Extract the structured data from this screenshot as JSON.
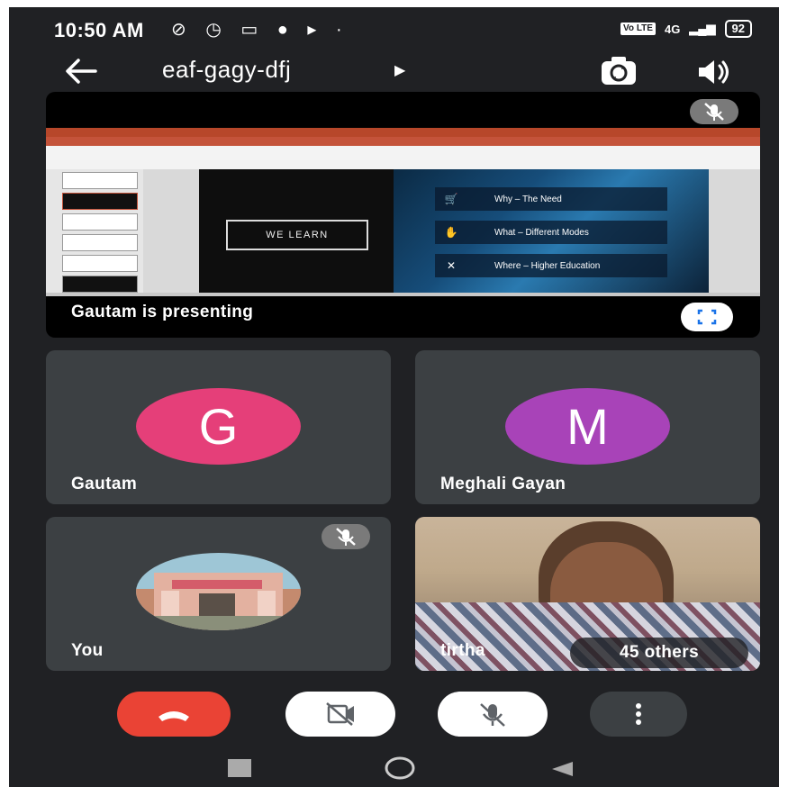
{
  "status_bar": {
    "time": "10:50 AM",
    "network": "4G",
    "network_badge": "Vo LTE",
    "battery": "92"
  },
  "header": {
    "meeting_code": "eaf-gagy-dfj"
  },
  "presentation": {
    "label": "Gautam is presenting",
    "slide_button": "WE LEARN",
    "slide_menu": [
      {
        "icon": "cart-icon",
        "label": "Why – The Need"
      },
      {
        "icon": "handshake-icon",
        "label": "What – Different Modes"
      },
      {
        "icon": "x-icon",
        "label": "Where – Higher Education"
      }
    ]
  },
  "participants": [
    {
      "name": "Gautam",
      "initial": "G",
      "avatar_color": "#e53f79"
    },
    {
      "name": "Meghali Gayan",
      "initial": "M",
      "avatar_color": "#a843b8"
    },
    {
      "name": "You"
    },
    {
      "name": "tirtha",
      "others": "45 others"
    }
  ],
  "colors": {
    "background": "#202124",
    "tile": "#3c4043",
    "end_call": "#ea4335",
    "control_light": "#ffffff",
    "control_dark": "#3c4043"
  }
}
